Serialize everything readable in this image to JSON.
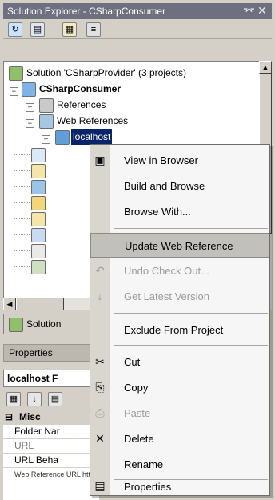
{
  "window": {
    "title": "Solution Explorer - CSharpConsumer",
    "pin_glyph": "⌤",
    "close_glyph": "✕"
  },
  "toolbar": {
    "buttons": [
      {
        "icon": "refresh-icon",
        "glyph": "↻"
      },
      {
        "icon": "show-all-files-icon",
        "glyph": "▤"
      },
      {
        "icon": "properties-icon",
        "glyph": "▦"
      },
      {
        "icon": "view-code-icon",
        "glyph": "≡"
      }
    ]
  },
  "tree": {
    "solution": "Solution 'CSharpProvider' (3 projects)",
    "project": "CSharpConsumer",
    "references": "References",
    "web_references": "Web References",
    "localhost": "localhost",
    "expand_glyph": "+",
    "collapse_glyph": "−"
  },
  "lower": {
    "solution_tab": "Solution",
    "properties_title": "Properties",
    "object_name": "localhost F",
    "grid_category": "Misc",
    "grid_rows": [
      "Folder Nar",
      "URL",
      "URL Beha"
    ],
    "last_row_text": "Web Reference URL http://localhost/CSharpProvider/CSharpProvider.asmx"
  },
  "menu": {
    "items": [
      {
        "label": "View in Browser",
        "icon": "browser-icon",
        "glyph": "▣",
        "enabled": true
      },
      {
        "label": "Build and Browse",
        "icon": "",
        "glyph": "",
        "enabled": true
      },
      {
        "label": "Browse With...",
        "icon": "",
        "glyph": "",
        "enabled": true
      },
      {
        "label": "Update Web Reference",
        "icon": "",
        "glyph": "",
        "enabled": true,
        "highlighted": true
      },
      {
        "label": "Undo Check Out...",
        "icon": "undo-checkout-icon",
        "glyph": "↶",
        "enabled": false
      },
      {
        "label": "Get Latest Version",
        "icon": "get-latest-icon",
        "glyph": "↓",
        "enabled": false
      },
      {
        "label": "Exclude From Project",
        "icon": "",
        "glyph": "",
        "enabled": true
      },
      {
        "label": "Cut",
        "icon": "cut-icon",
        "glyph": "✂",
        "enabled": true
      },
      {
        "label": "Copy",
        "icon": "copy-icon",
        "glyph": "⎘",
        "enabled": true
      },
      {
        "label": "Paste",
        "icon": "paste-icon",
        "glyph": "⎙",
        "enabled": false
      },
      {
        "label": "Delete",
        "icon": "delete-icon",
        "glyph": "✕",
        "enabled": true
      },
      {
        "label": "Rename",
        "icon": "",
        "glyph": "",
        "enabled": true
      },
      {
        "label": "Properties",
        "icon": "properties-icon",
        "glyph": "▤",
        "enabled": true
      }
    ]
  },
  "colors": {
    "title_bar": "#6e7080",
    "selection": "#0a246a",
    "menu_highlight": "#c1c0bb"
  }
}
